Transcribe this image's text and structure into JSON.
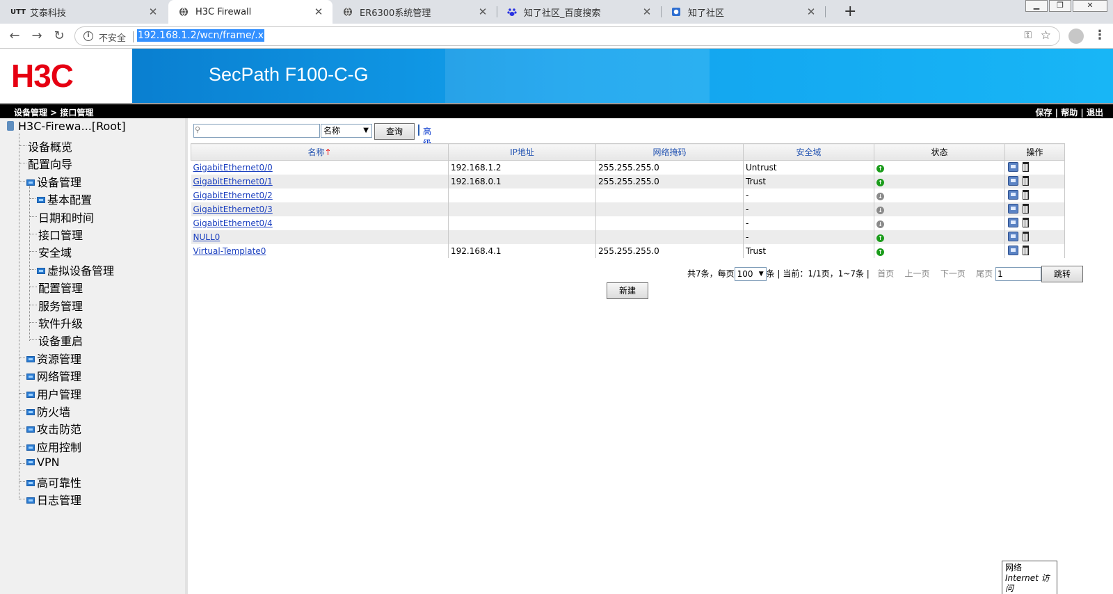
{
  "browser": {
    "tabs": [
      {
        "title": "艾泰科技",
        "favicon": "UTT",
        "active": false
      },
      {
        "title": "H3C Firewall",
        "favicon": "globe",
        "active": true
      },
      {
        "title": "ER6300系统管理",
        "favicon": "globe",
        "active": false
      },
      {
        "title": "知了社区_百度搜索",
        "favicon": "baidu-paw",
        "active": false
      },
      {
        "title": "知了社区",
        "favicon": "zhiliao",
        "active": false
      }
    ],
    "close_glyph": "✕",
    "new_tab_glyph": "+",
    "insecure_label": "不安全",
    "url": "192.168.1.2/wcn/frame/.x"
  },
  "banner": {
    "logo": "H3C",
    "product": "SecPath F100-C-G"
  },
  "topbar": {
    "breadcrumb": "设备管理 > 接口管理",
    "save": "保存",
    "help": "帮助",
    "logout": "退出",
    "sep": " | "
  },
  "sidebar": {
    "root": "H3C-Firewa...[Root]",
    "items": [
      {
        "label": "设备概览",
        "level": 1,
        "folder": false
      },
      {
        "label": "配置向导",
        "level": 1,
        "folder": false
      },
      {
        "label": "设备管理",
        "level": 1,
        "folder": true
      },
      {
        "label": "基本配置",
        "level": 2,
        "folder": true
      },
      {
        "label": "日期和时间",
        "level": 2,
        "folder": false
      },
      {
        "label": "接口管理",
        "level": 2,
        "folder": false
      },
      {
        "label": "安全域",
        "level": 2,
        "folder": false
      },
      {
        "label": "虚拟设备管理",
        "level": 2,
        "folder": true
      },
      {
        "label": "配置管理",
        "level": 2,
        "folder": false
      },
      {
        "label": "服务管理",
        "level": 2,
        "folder": false
      },
      {
        "label": "软件升级",
        "level": 2,
        "folder": false
      },
      {
        "label": "设备重启",
        "level": 2,
        "folder": false
      },
      {
        "label": "资源管理",
        "level": 1,
        "folder": true
      },
      {
        "label": "网络管理",
        "level": 1,
        "folder": true
      },
      {
        "label": "用户管理",
        "level": 1,
        "folder": true
      },
      {
        "label": "防火墙",
        "level": 1,
        "folder": true
      },
      {
        "label": "攻击防范",
        "level": 1,
        "folder": true
      },
      {
        "label": "应用控制",
        "level": 1,
        "folder": true
      },
      {
        "label": "VPN",
        "level": 1,
        "folder": true
      },
      {
        "label": "高可靠性",
        "level": 1,
        "folder": true
      },
      {
        "label": "日志管理",
        "level": 1,
        "folder": true
      }
    ]
  },
  "search": {
    "field_value": "名称",
    "query_button": "查询",
    "advanced": "高级查询"
  },
  "table": {
    "headers": [
      "名称",
      "IP地址",
      "网络掩码",
      "安全域",
      "状态",
      "操作"
    ],
    "sort_arrow": "↑",
    "rows": [
      {
        "name": "GigabitEthernet0/0",
        "ip": "192.168.1.2",
        "mask": "255.255.255.0",
        "zone": "Untrust",
        "status": "up"
      },
      {
        "name": "GigabitEthernet0/1",
        "ip": "192.168.0.1",
        "mask": "255.255.255.0",
        "zone": "Trust",
        "status": "up"
      },
      {
        "name": "GigabitEthernet0/2",
        "ip": "",
        "mask": "",
        "zone": "-",
        "status": "down"
      },
      {
        "name": "GigabitEthernet0/3",
        "ip": "",
        "mask": "",
        "zone": "-",
        "status": "down"
      },
      {
        "name": "GigabitEthernet0/4",
        "ip": "",
        "mask": "",
        "zone": "-",
        "status": "down"
      },
      {
        "name": "NULL0",
        "ip": "",
        "mask": "",
        "zone": "-",
        "status": "up"
      },
      {
        "name": "Virtual-Template0",
        "ip": "192.168.4.1",
        "mask": "255.255.255.0",
        "zone": "Trust",
        "status": "up"
      }
    ]
  },
  "pager": {
    "summary_prefix": "共7条，每页",
    "page_size": "100",
    "summary_suffix": "条 | 当前：1/1页，1~7条 |",
    "first": "首页",
    "prev": "上一页",
    "next": "下一页",
    "last": "尾页",
    "jump_value": "1",
    "jump_button": "跳转"
  },
  "new_button": "新建",
  "network_popup": {
    "line1": "网络",
    "line2": "Internet 访问"
  },
  "colors": {
    "banner_blue": "#00a8ec",
    "logo_red": "#e60012",
    "link_blue": "#1a3fbf",
    "status_up": "#1b9c1b"
  }
}
